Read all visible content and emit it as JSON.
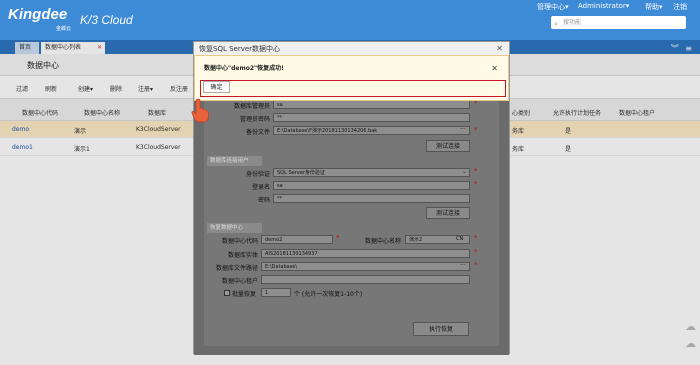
{
  "header": {
    "logo": "Kingdee",
    "logo_sub": "金蝶云",
    "product": "K/3 Cloud",
    "menu": {
      "manage": "管理中心",
      "manage_arrow": "▾",
      "user": "Administrator",
      "user_arrow": "▾",
      "help": "帮助",
      "help_arrow": "▾",
      "logout": "注销"
    },
    "search_placeholder": "搜功能"
  },
  "tabs": [
    {
      "label": "首页"
    },
    {
      "label": "数据中心列表"
    }
  ],
  "page_title": "数据中心",
  "toolbar": {
    "filter": "过滤",
    "refresh": "刷新",
    "create": "创建",
    "create_arrow": "▾",
    "delete": "删除",
    "register": "注册",
    "register_arrow": "▾",
    "unregister": "反注册"
  },
  "grid": {
    "columns": {
      "code": "数据中心代码",
      "name": "数据中心名称",
      "server": "数据库",
      "category": "心类别",
      "allow": "允许执行计划任务",
      "tenant": "数据中心租户"
    },
    "rows": [
      {
        "code": "demo",
        "name": "演示",
        "server": "K3CloudServer",
        "category": "务库",
        "allow": "是"
      },
      {
        "code": "demo1",
        "name": "演示1",
        "server": "K3CloudServer",
        "category": "务库",
        "allow": "是"
      }
    ]
  },
  "dialog": {
    "title": "恢复SQL Server数据中心",
    "close": "✕",
    "form": {
      "db_admin_label": "数据库管理员",
      "db_admin_value": "sa",
      "admin_pwd_label": "管理员密码",
      "admin_pwd_value": "**",
      "backup_label": "备份文件",
      "backup_value": "E:\\Database\\F演示20181130134206.bak",
      "test_conn_1": "测试连接",
      "sec_db_user": "数据库连接用户",
      "auth_label": "身份验证",
      "auth_value": "SQL Server身份验证",
      "login_label": "登录名",
      "login_value": "sa",
      "pwd_label": "密码",
      "pwd_value": "**",
      "test_conn_2": "测试连接",
      "sec_restore": "恢复数据中心",
      "dc_code_label": "数据中心代码",
      "dc_code_value": "demo2",
      "dc_name_label": "数据中心名称",
      "dc_name_value": "演示2",
      "dc_name_lang": "CN",
      "db_instance_label": "数据库实体",
      "db_instance_value": "AIS20181130134937",
      "db_path_label": "数据库文件路径",
      "db_path_value": "E:\\Database\\",
      "tenant_label": "数据中心租户",
      "batch_label": "批量恢复",
      "batch_value": "1",
      "batch_hint": "个 (允许一次恢复1-10个)",
      "restore_button": "执行恢复"
    }
  },
  "message": {
    "text": "数据中心\"demo2\"恢复成功!",
    "close": "✕",
    "ok": "确定"
  }
}
